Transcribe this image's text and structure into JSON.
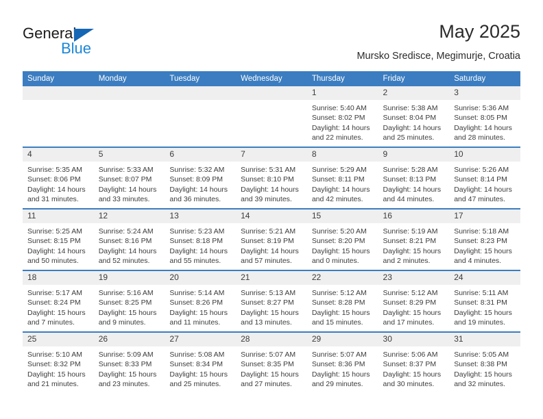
{
  "brand": {
    "name_part1": "General",
    "name_part2": "Blue"
  },
  "header": {
    "title": "May 2025",
    "subtitle": "Mursko Sredisce, Megimurje, Croatia"
  },
  "calendar": {
    "weekday_headers": [
      "Sunday",
      "Monday",
      "Tuesday",
      "Wednesday",
      "Thursday",
      "Friday",
      "Saturday"
    ],
    "accent_color": "#3b7dc0",
    "daynum_band_color": "#efefef",
    "weeks": [
      [
        {
          "day": "",
          "empty": true,
          "sunrise": "",
          "sunset": "",
          "daylight_line1": "",
          "daylight_line2": ""
        },
        {
          "day": "",
          "empty": true,
          "sunrise": "",
          "sunset": "",
          "daylight_line1": "",
          "daylight_line2": ""
        },
        {
          "day": "",
          "empty": true,
          "sunrise": "",
          "sunset": "",
          "daylight_line1": "",
          "daylight_line2": ""
        },
        {
          "day": "",
          "empty": true,
          "sunrise": "",
          "sunset": "",
          "daylight_line1": "",
          "daylight_line2": ""
        },
        {
          "day": "1",
          "empty": false,
          "sunrise": "Sunrise: 5:40 AM",
          "sunset": "Sunset: 8:02 PM",
          "daylight_line1": "Daylight: 14 hours",
          "daylight_line2": "and 22 minutes."
        },
        {
          "day": "2",
          "empty": false,
          "sunrise": "Sunrise: 5:38 AM",
          "sunset": "Sunset: 8:04 PM",
          "daylight_line1": "Daylight: 14 hours",
          "daylight_line2": "and 25 minutes."
        },
        {
          "day": "3",
          "empty": false,
          "sunrise": "Sunrise: 5:36 AM",
          "sunset": "Sunset: 8:05 PM",
          "daylight_line1": "Daylight: 14 hours",
          "daylight_line2": "and 28 minutes."
        }
      ],
      [
        {
          "day": "4",
          "empty": false,
          "sunrise": "Sunrise: 5:35 AM",
          "sunset": "Sunset: 8:06 PM",
          "daylight_line1": "Daylight: 14 hours",
          "daylight_line2": "and 31 minutes."
        },
        {
          "day": "5",
          "empty": false,
          "sunrise": "Sunrise: 5:33 AM",
          "sunset": "Sunset: 8:07 PM",
          "daylight_line1": "Daylight: 14 hours",
          "daylight_line2": "and 33 minutes."
        },
        {
          "day": "6",
          "empty": false,
          "sunrise": "Sunrise: 5:32 AM",
          "sunset": "Sunset: 8:09 PM",
          "daylight_line1": "Daylight: 14 hours",
          "daylight_line2": "and 36 minutes."
        },
        {
          "day": "7",
          "empty": false,
          "sunrise": "Sunrise: 5:31 AM",
          "sunset": "Sunset: 8:10 PM",
          "daylight_line1": "Daylight: 14 hours",
          "daylight_line2": "and 39 minutes."
        },
        {
          "day": "8",
          "empty": false,
          "sunrise": "Sunrise: 5:29 AM",
          "sunset": "Sunset: 8:11 PM",
          "daylight_line1": "Daylight: 14 hours",
          "daylight_line2": "and 42 minutes."
        },
        {
          "day": "9",
          "empty": false,
          "sunrise": "Sunrise: 5:28 AM",
          "sunset": "Sunset: 8:13 PM",
          "daylight_line1": "Daylight: 14 hours",
          "daylight_line2": "and 44 minutes."
        },
        {
          "day": "10",
          "empty": false,
          "sunrise": "Sunrise: 5:26 AM",
          "sunset": "Sunset: 8:14 PM",
          "daylight_line1": "Daylight: 14 hours",
          "daylight_line2": "and 47 minutes."
        }
      ],
      [
        {
          "day": "11",
          "empty": false,
          "sunrise": "Sunrise: 5:25 AM",
          "sunset": "Sunset: 8:15 PM",
          "daylight_line1": "Daylight: 14 hours",
          "daylight_line2": "and 50 minutes."
        },
        {
          "day": "12",
          "empty": false,
          "sunrise": "Sunrise: 5:24 AM",
          "sunset": "Sunset: 8:16 PM",
          "daylight_line1": "Daylight: 14 hours",
          "daylight_line2": "and 52 minutes."
        },
        {
          "day": "13",
          "empty": false,
          "sunrise": "Sunrise: 5:23 AM",
          "sunset": "Sunset: 8:18 PM",
          "daylight_line1": "Daylight: 14 hours",
          "daylight_line2": "and 55 minutes."
        },
        {
          "day": "14",
          "empty": false,
          "sunrise": "Sunrise: 5:21 AM",
          "sunset": "Sunset: 8:19 PM",
          "daylight_line1": "Daylight: 14 hours",
          "daylight_line2": "and 57 minutes."
        },
        {
          "day": "15",
          "empty": false,
          "sunrise": "Sunrise: 5:20 AM",
          "sunset": "Sunset: 8:20 PM",
          "daylight_line1": "Daylight: 15 hours",
          "daylight_line2": "and 0 minutes."
        },
        {
          "day": "16",
          "empty": false,
          "sunrise": "Sunrise: 5:19 AM",
          "sunset": "Sunset: 8:21 PM",
          "daylight_line1": "Daylight: 15 hours",
          "daylight_line2": "and 2 minutes."
        },
        {
          "day": "17",
          "empty": false,
          "sunrise": "Sunrise: 5:18 AM",
          "sunset": "Sunset: 8:23 PM",
          "daylight_line1": "Daylight: 15 hours",
          "daylight_line2": "and 4 minutes."
        }
      ],
      [
        {
          "day": "18",
          "empty": false,
          "sunrise": "Sunrise: 5:17 AM",
          "sunset": "Sunset: 8:24 PM",
          "daylight_line1": "Daylight: 15 hours",
          "daylight_line2": "and 7 minutes."
        },
        {
          "day": "19",
          "empty": false,
          "sunrise": "Sunrise: 5:16 AM",
          "sunset": "Sunset: 8:25 PM",
          "daylight_line1": "Daylight: 15 hours",
          "daylight_line2": "and 9 minutes."
        },
        {
          "day": "20",
          "empty": false,
          "sunrise": "Sunrise: 5:14 AM",
          "sunset": "Sunset: 8:26 PM",
          "daylight_line1": "Daylight: 15 hours",
          "daylight_line2": "and 11 minutes."
        },
        {
          "day": "21",
          "empty": false,
          "sunrise": "Sunrise: 5:13 AM",
          "sunset": "Sunset: 8:27 PM",
          "daylight_line1": "Daylight: 15 hours",
          "daylight_line2": "and 13 minutes."
        },
        {
          "day": "22",
          "empty": false,
          "sunrise": "Sunrise: 5:12 AM",
          "sunset": "Sunset: 8:28 PM",
          "daylight_line1": "Daylight: 15 hours",
          "daylight_line2": "and 15 minutes."
        },
        {
          "day": "23",
          "empty": false,
          "sunrise": "Sunrise: 5:12 AM",
          "sunset": "Sunset: 8:29 PM",
          "daylight_line1": "Daylight: 15 hours",
          "daylight_line2": "and 17 minutes."
        },
        {
          "day": "24",
          "empty": false,
          "sunrise": "Sunrise: 5:11 AM",
          "sunset": "Sunset: 8:31 PM",
          "daylight_line1": "Daylight: 15 hours",
          "daylight_line2": "and 19 minutes."
        }
      ],
      [
        {
          "day": "25",
          "empty": false,
          "sunrise": "Sunrise: 5:10 AM",
          "sunset": "Sunset: 8:32 PM",
          "daylight_line1": "Daylight: 15 hours",
          "daylight_line2": "and 21 minutes."
        },
        {
          "day": "26",
          "empty": false,
          "sunrise": "Sunrise: 5:09 AM",
          "sunset": "Sunset: 8:33 PM",
          "daylight_line1": "Daylight: 15 hours",
          "daylight_line2": "and 23 minutes."
        },
        {
          "day": "27",
          "empty": false,
          "sunrise": "Sunrise: 5:08 AM",
          "sunset": "Sunset: 8:34 PM",
          "daylight_line1": "Daylight: 15 hours",
          "daylight_line2": "and 25 minutes."
        },
        {
          "day": "28",
          "empty": false,
          "sunrise": "Sunrise: 5:07 AM",
          "sunset": "Sunset: 8:35 PM",
          "daylight_line1": "Daylight: 15 hours",
          "daylight_line2": "and 27 minutes."
        },
        {
          "day": "29",
          "empty": false,
          "sunrise": "Sunrise: 5:07 AM",
          "sunset": "Sunset: 8:36 PM",
          "daylight_line1": "Daylight: 15 hours",
          "daylight_line2": "and 29 minutes."
        },
        {
          "day": "30",
          "empty": false,
          "sunrise": "Sunrise: 5:06 AM",
          "sunset": "Sunset: 8:37 PM",
          "daylight_line1": "Daylight: 15 hours",
          "daylight_line2": "and 30 minutes."
        },
        {
          "day": "31",
          "empty": false,
          "sunrise": "Sunrise: 5:05 AM",
          "sunset": "Sunset: 8:38 PM",
          "daylight_line1": "Daylight: 15 hours",
          "daylight_line2": "and 32 minutes."
        }
      ]
    ]
  }
}
